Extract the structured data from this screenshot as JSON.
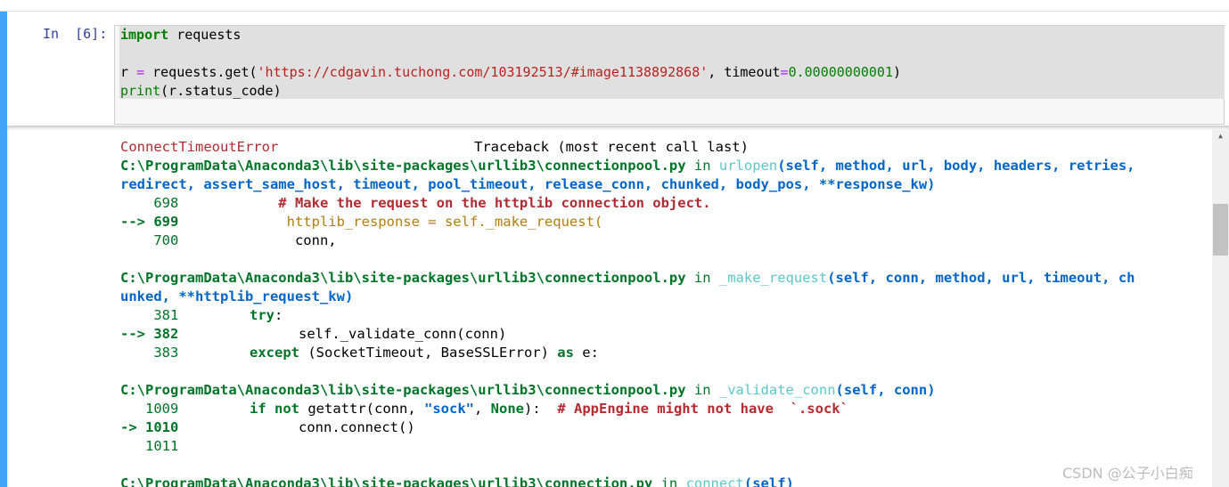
{
  "cell": {
    "prompt": "In  [6]:",
    "code": {
      "line1": {
        "kw": "import",
        "rest": " requests"
      },
      "line2": {
        "var": "r ",
        "eq": "=",
        "call": " requests.get(",
        "url": "'https://cdgavin.tuchong.com/103192513/#image1138892868'",
        "sep": ", timeout",
        "eq2": "=",
        "num": "0.00000000001",
        "close": ")"
      },
      "line3": {
        "fn": "print",
        "rest": "(r.status_code)"
      }
    }
  },
  "traceback": {
    "error_name": "ConnectTimeoutError",
    "header": "Traceback (most recent call last)",
    "frames": [
      {
        "path": "C:\\ProgramData\\Anaconda3\\lib\\site-packages\\urllib3\\connectionpool.py",
        "in": " in ",
        "func": "urlopen",
        "args_line1": "(self, method, url, body, headers, retries,",
        "args_line2": "redirect, assert_same_host, timeout, pool_timeout, release_conn, chunked, body_pos, **response_kw)",
        "l1_no": "    698",
        "l1_code": "            # Make the request on the httplib connection object.",
        "l2_no": "--> 699",
        "l2_code": "             httplib_response = self._make_request(",
        "l3_no": "    700",
        "l3_code": "              conn,"
      },
      {
        "path": "C:\\ProgramData\\Anaconda3\\lib\\site-packages\\urllib3\\connectionpool.py",
        "in": " in ",
        "func": "_make_request",
        "args_line1": "(self, conn, method, url, timeout, ch",
        "args_line2": "unked, **httplib_request_kw)",
        "l1_no": "    381",
        "l1_kw": "try",
        "l1_rest": ":",
        "l2_no": "--> 382",
        "l2_code": "self._validate_conn(conn)",
        "l3_no": "    383",
        "l3_kw": "except",
        "l3_rest": " (SocketTimeout, BaseSSLError) ",
        "l3_as": "as",
        "l3_e": " e:"
      },
      {
        "path": "C:\\ProgramData\\Anaconda3\\lib\\site-packages\\urllib3\\connectionpool.py",
        "in": " in ",
        "func": "_validate_conn",
        "args_line1": "(self, conn)",
        "l1_no": "   1009",
        "l1_if": "if",
        "l1_not": "not",
        "l1_call": " getattr(conn, ",
        "l1_str": "\"sock\"",
        "l1_sep": ", ",
        "l1_none": "None",
        "l1_close": "):  ",
        "l1_comment": "# AppEngine might not have  `.sock`",
        "l2_no": "-> 1010",
        "l2_code": "conn.connect()",
        "l3_no": "   1011"
      },
      {
        "path": "C:\\ProgramData\\Anaconda3\\lib\\site-packages\\urllib3\\connection.py",
        "in": " in ",
        "func": "connect",
        "args_line1": "(self)"
      }
    ]
  },
  "watermark": "CSDN @公子小白痴",
  "colors": {
    "cell_indicator": "#42a5f5",
    "prompt": "#303f9f",
    "error_red": "#b22b31",
    "path_green": "#007427",
    "func_cyan": "#60c6c8",
    "args_blue": "#0065ca",
    "code_yellow": "#b27d12"
  },
  "icons": {
    "scroll_up": "triangle-up-icon"
  }
}
